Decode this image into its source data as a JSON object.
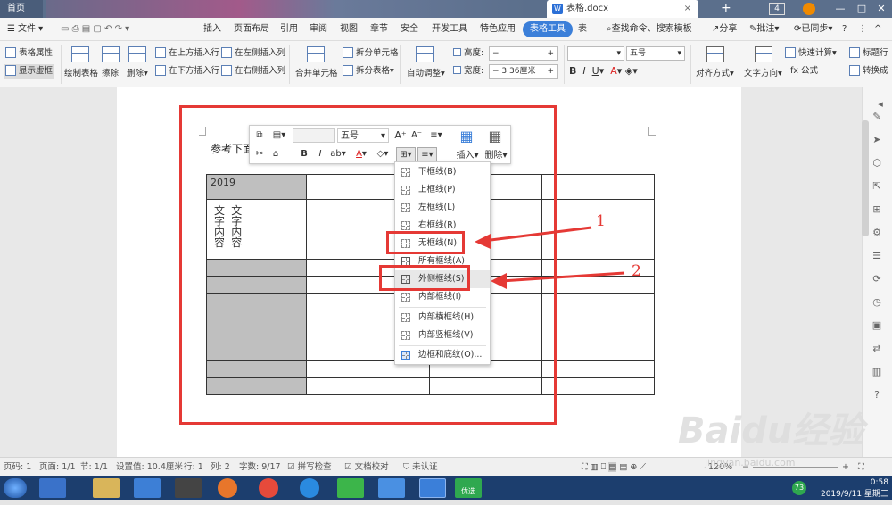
{
  "tabs": {
    "home": "首页",
    "doc": "表格.docx",
    "close": "×",
    "plus": "+",
    "win_count": "4"
  },
  "menu": {
    "file": "文件",
    "items": [
      "插入",
      "页面布局",
      "引用",
      "审阅",
      "视图",
      "章节",
      "安全",
      "开发工具",
      "特色应用"
    ],
    "table_tools": "表格工具",
    "table_style": "表",
    "search": "查找命令、搜索模板",
    "share": "分享",
    "annotate": "批注",
    "sync": "已同步",
    "help": "?"
  },
  "ribbon": {
    "table_props": "表格属性",
    "show_dashed": "显示虚框",
    "draw_table": "绘制表格",
    "erase": "擦除",
    "delete": "删除",
    "insert_above": "在上方插入行",
    "insert_left": "在左侧插入列",
    "insert_below": "在下方插入行",
    "insert_right": "在右侧插入列",
    "merge_cells": "合并单元格",
    "split_cells": "拆分单元格",
    "split_table": "拆分表格",
    "auto_fit": "自动调整",
    "height_label": "高度:",
    "width_label": "宽度:",
    "width_value": "3.36厘米",
    "font_size": "五号",
    "align": "对齐方式",
    "text_dir": "文字方向",
    "quick_calc": "快速计算",
    "formula": "fx 公式",
    "title_row": "标题行",
    "convert": "转换成"
  },
  "doc": {
    "body_text": "参考下面",
    "cell_year": "2019",
    "cell_vertical_1": "文字内容",
    "cell_vertical_2": "文字内容"
  },
  "float_toolbar": {
    "font_size": "五号",
    "insert": "插入",
    "delete": "删除",
    "bold": "B",
    "italic": "I"
  },
  "dropdown": {
    "items": [
      {
        "label": "下框线(B)"
      },
      {
        "label": "上框线(P)"
      },
      {
        "label": "左框线(L)"
      },
      {
        "label": "右框线(R)"
      },
      {
        "label": "无框线(N)"
      },
      {
        "label": "所有框线(A)"
      },
      {
        "label": "外侧框线(S)"
      },
      {
        "label": "内部框线(I)"
      },
      {
        "label": "内部横框线(H)"
      },
      {
        "label": "内部竖框线(V)"
      },
      {
        "label": "边框和底纹(O)..."
      }
    ]
  },
  "annotations": {
    "label_1": "1",
    "label_2": "2",
    "color": "#e53935"
  },
  "statusbar": {
    "page_num": "页码: 1",
    "pages": "页面: 1/1",
    "section": "节: 1/1",
    "setting": "设置值: 10.4厘米",
    "row": "行: 1",
    "col": "列: 2",
    "words": "字数: 9/17",
    "spell": "拼写检查",
    "doc_check": "文档校对",
    "uncertified": "未认证",
    "zoom": "120%"
  },
  "taskbar": {
    "time": "0:58",
    "date": "2019/9/11 星期三",
    "badge": "73",
    "youxuan": "优选"
  },
  "watermark": {
    "logo": "Baidu经验",
    "url": "jingyan.baidu.com"
  }
}
